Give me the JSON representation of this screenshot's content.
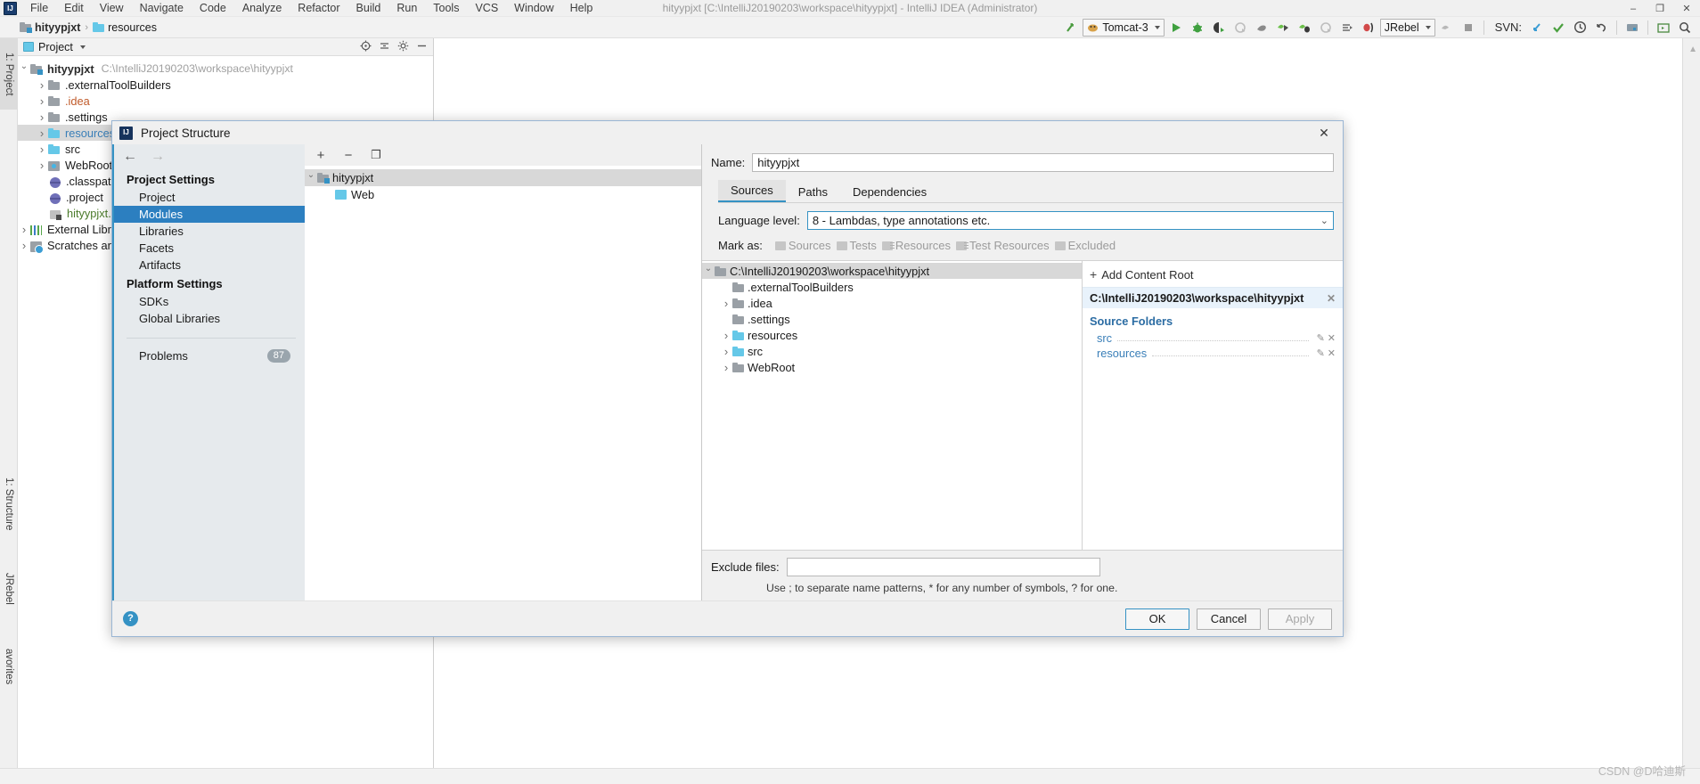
{
  "window": {
    "title": "hityypjxt [C:\\IntelliJ20190203\\workspace\\hityypjxt] - IntelliJ IDEA (Administrator)",
    "logo_text": "IJ",
    "minimize": "–",
    "maximize": "❐",
    "close": "✕"
  },
  "menu": [
    {
      "label": "File"
    },
    {
      "label": "Edit"
    },
    {
      "label": "View"
    },
    {
      "label": "Navigate"
    },
    {
      "label": "Code"
    },
    {
      "label": "Analyze"
    },
    {
      "label": "Refactor"
    },
    {
      "label": "Build"
    },
    {
      "label": "Run"
    },
    {
      "label": "Tools"
    },
    {
      "label": "VCS"
    },
    {
      "label": "Window"
    },
    {
      "label": "Help"
    }
  ],
  "navbar": {
    "breadcrumb": [
      {
        "label": "hityypjxt",
        "icon": "module-icon"
      },
      {
        "label": "resources",
        "icon": "folder-icon"
      }
    ],
    "separator": "›",
    "run_config": "Tomcat-3",
    "jrebel_config": "JRebel",
    "svn_label": "SVN:"
  },
  "left_tool_strips": [
    {
      "label": "1: Project",
      "selected": true
    },
    {
      "label": "1: Structure",
      "selected": false
    },
    {
      "label": "JRebel",
      "selected": false
    },
    {
      "label": "avorites",
      "selected": false
    }
  ],
  "project_window": {
    "header_label": "Project",
    "tree": [
      {
        "label": "hityypjxt",
        "path": "C:\\IntelliJ20190203\\workspace\\hityypjxt",
        "indent": 0,
        "arrow": "open",
        "icon": "module-icon",
        "selected": false,
        "color": "#2b2b2b",
        "bold": true
      },
      {
        "label": ".externalToolBuilders",
        "path": "",
        "indent": 1,
        "arrow": "closed",
        "icon": "folder-grey",
        "selected": false,
        "color": "#1a1a1a",
        "bold": false
      },
      {
        "label": ".idea",
        "path": "",
        "indent": 1,
        "arrow": "closed",
        "icon": "folder-grey",
        "selected": false,
        "color": "#c05a2a",
        "bold": false
      },
      {
        "label": ".settings",
        "path": "",
        "indent": 1,
        "arrow": "closed",
        "icon": "folder-grey",
        "selected": false,
        "color": "#1a1a1a",
        "bold": false
      },
      {
        "label": "resources",
        "path": "",
        "indent": 1,
        "arrow": "closed",
        "icon": "folder-cyan",
        "selected": true,
        "color": "#3a7fb8",
        "bold": false
      },
      {
        "label": "src",
        "path": "",
        "indent": 1,
        "arrow": "closed",
        "icon": "folder-cyan",
        "selected": false,
        "color": "#1a1a1a",
        "bold": false
      },
      {
        "label": "WebRoot",
        "path": "",
        "indent": 1,
        "arrow": "closed",
        "icon": "web-icon",
        "selected": false,
        "color": "#1a1a1a",
        "bold": false
      },
      {
        "label": ".classpath",
        "path": "",
        "indent": 2,
        "arrow": "none",
        "icon": "jar-icon",
        "selected": false,
        "color": "#1a1a1a",
        "bold": false
      },
      {
        "label": ".project",
        "path": "",
        "indent": 2,
        "arrow": "none",
        "icon": "jar-icon",
        "selected": false,
        "color": "#1a1a1a",
        "bold": false
      },
      {
        "label": "hityypjxt.iml",
        "path": "",
        "indent": 2,
        "arrow": "none",
        "icon": "module-icon",
        "selected": false,
        "color": "#4a7a2a",
        "bold": false
      },
      {
        "label": "External Librari",
        "path": "",
        "indent": 0,
        "arrow": "closed",
        "icon": "library-icon",
        "selected": false,
        "color": "#1a1a1a",
        "bold": false
      },
      {
        "label": "Scratches and",
        "path": "",
        "indent": 0,
        "arrow": "closed",
        "icon": "scratch-icon",
        "selected": false,
        "color": "#1a1a1a",
        "bold": false
      }
    ]
  },
  "dialog": {
    "title": "Project Structure",
    "logo_text": "IJ",
    "close_label": "✕",
    "nav": {
      "back_arrow": "←",
      "forward_arrow": "→",
      "groups": [
        {
          "title": "Project Settings",
          "items": [
            {
              "label": "Project",
              "selected": false,
              "badge": ""
            },
            {
              "label": "Modules",
              "selected": true,
              "badge": ""
            },
            {
              "label": "Libraries",
              "selected": false,
              "badge": ""
            },
            {
              "label": "Facets",
              "selected": false,
              "badge": ""
            },
            {
              "label": "Artifacts",
              "selected": false,
              "badge": ""
            }
          ]
        },
        {
          "title": "Platform Settings",
          "items": [
            {
              "label": "SDKs",
              "selected": false,
              "badge": ""
            },
            {
              "label": "Global Libraries",
              "selected": false,
              "badge": ""
            }
          ]
        }
      ],
      "problems": {
        "label": "Problems",
        "badge": "87"
      }
    },
    "modules_toolbar": {
      "add": "+",
      "remove": "−",
      "copy": "❐"
    },
    "modules_tree": [
      {
        "label": "hityypjxt",
        "indent": 0,
        "arrow": "open",
        "icon": "module-icon",
        "selected": true
      },
      {
        "label": "Web",
        "indent": 1,
        "arrow": "none",
        "icon": "web-facet-icon",
        "selected": false
      }
    ],
    "detail": {
      "name_label": "Name:",
      "name_value": "hityypjxt",
      "tabs": [
        {
          "label": "Sources",
          "selected": true
        },
        {
          "label": "Paths",
          "selected": false
        },
        {
          "label": "Dependencies",
          "selected": false
        }
      ],
      "language_level_label": "Language level:",
      "language_level_value": "8 - Lambdas, type annotations etc.",
      "mark_as_label": "Mark as:",
      "mark_as_options": [
        {
          "label": "Sources",
          "icon": "folder-icon"
        },
        {
          "label": "Tests",
          "icon": "folder-icon"
        },
        {
          "label": "Resources",
          "icon": "resources-folder-icon"
        },
        {
          "label": "Test Resources",
          "icon": "test-resources-folder-icon"
        },
        {
          "label": "Excluded",
          "icon": "folder-icon"
        }
      ],
      "content_tree": [
        {
          "label": "C:\\IntelliJ20190203\\workspace\\hityypjxt",
          "indent": 0,
          "arrow": "open",
          "icon": "folder-grey",
          "selected": true,
          "color": "#1a1a1a"
        },
        {
          "label": ".externalToolBuilders",
          "indent": 1,
          "arrow": "none",
          "icon": "folder-grey",
          "selected": false,
          "color": "#1a1a1a"
        },
        {
          "label": ".idea",
          "indent": 1,
          "arrow": "closed",
          "icon": "folder-grey",
          "selected": false,
          "color": "#1a1a1a"
        },
        {
          "label": ".settings",
          "indent": 1,
          "arrow": "none",
          "icon": "folder-grey",
          "selected": false,
          "color": "#1a1a1a"
        },
        {
          "label": "resources",
          "indent": 1,
          "arrow": "closed",
          "icon": "folder-cyan",
          "selected": false,
          "color": "#1a1a1a"
        },
        {
          "label": "src",
          "indent": 1,
          "arrow": "closed",
          "icon": "folder-cyan",
          "selected": false,
          "color": "#1a1a1a"
        },
        {
          "label": "WebRoot",
          "indent": 1,
          "arrow": "closed",
          "icon": "folder-grey",
          "selected": false,
          "color": "#1a1a1a"
        }
      ],
      "source_panel": {
        "add_content_root": "Add Content Root",
        "add_icon": "+",
        "root_path": "C:\\IntelliJ20190203\\workspace\\hityypjxt",
        "root_remove_icon": "✕",
        "section_title": "Source Folders",
        "folders": [
          {
            "label": "src",
            "edit_icon": "✎",
            "remove_icon": "✕"
          },
          {
            "label": "resources",
            "edit_icon": "✎",
            "remove_icon": "✕"
          }
        ]
      },
      "exclude_label": "Exclude files:",
      "exclude_value": "",
      "exclude_hint": "Use ; to separate name patterns, * for any number of symbols, ? for one."
    },
    "footer": {
      "help": "?",
      "ok": "OK",
      "cancel": "Cancel",
      "apply": "Apply"
    }
  },
  "watermark": "CSDN @D哈迪斯"
}
